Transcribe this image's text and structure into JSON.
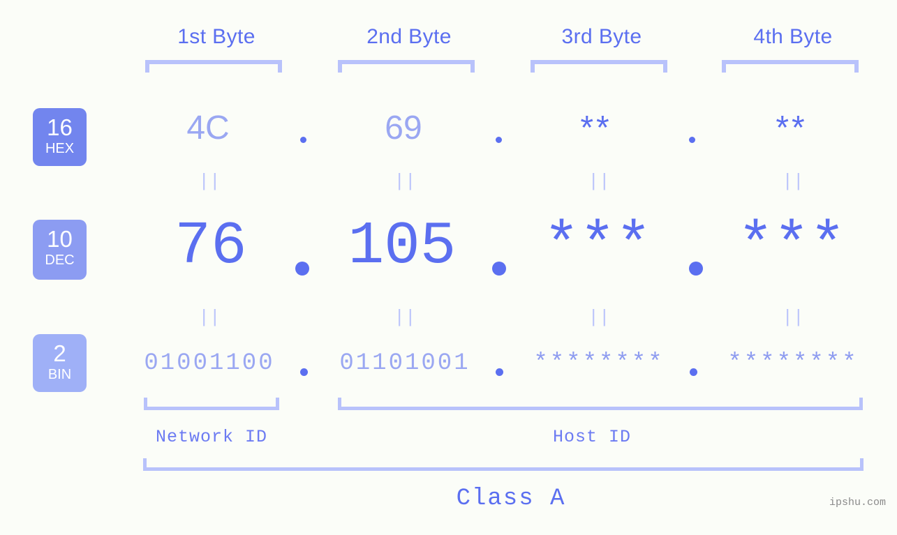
{
  "background": "#fbfdf8",
  "accent": "#5b6ff0",
  "accent_light": "#9aa7f2",
  "accent_pale": "#b8c2fb",
  "headers": {
    "byte1": "1st Byte",
    "byte2": "2nd Byte",
    "byte3": "3rd Byte",
    "byte4": "4th Byte"
  },
  "bases": [
    {
      "num": "16",
      "label": "HEX",
      "color": "#7285ee"
    },
    {
      "num": "10",
      "label": "DEC",
      "color": "#8c9cf2"
    },
    {
      "num": "2",
      "label": "BIN",
      "color": "#9fb0f7"
    }
  ],
  "rows": {
    "hex": {
      "base_num": "16",
      "base_label": "HEX",
      "byte1": "4C",
      "byte2": "69",
      "byte3": "**",
      "byte4": "**"
    },
    "dec": {
      "base_num": "10",
      "base_label": "DEC",
      "byte1": "76",
      "byte2": "105",
      "byte3": "***",
      "byte4": "***"
    },
    "bin": {
      "base_num": "2",
      "base_label": "BIN",
      "byte1": "01001100",
      "byte2": "01101001",
      "byte3": "********",
      "byte4": "********"
    }
  },
  "separators": {
    "dot": ".",
    "equals": "||"
  },
  "sections": {
    "network_id": "Network ID",
    "host_id": "Host ID",
    "class": "Class A"
  },
  "watermark": "ipshu.com"
}
